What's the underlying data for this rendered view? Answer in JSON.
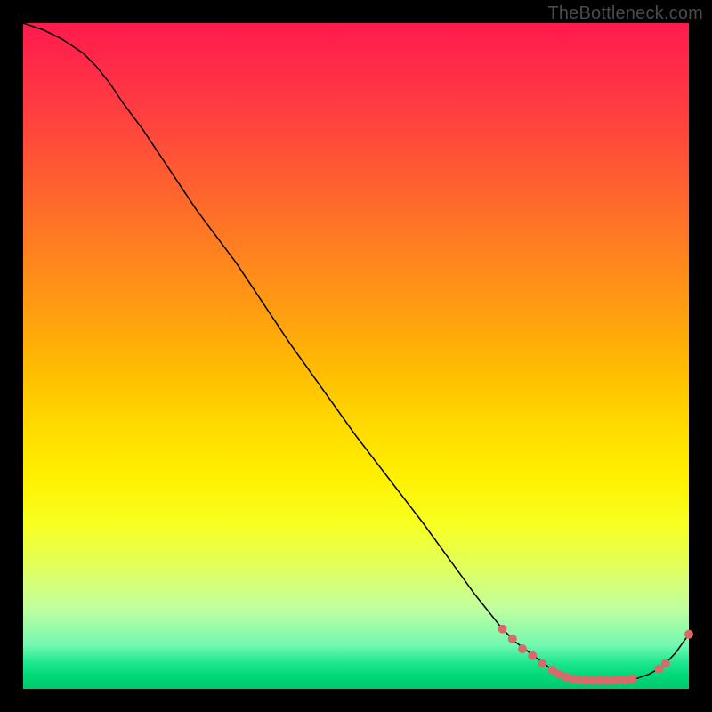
{
  "watermark_text": "TheBottleneck.com",
  "colors": {
    "black": "#000000",
    "dot": "#d86a6a",
    "gradient_top": "#ff1a4d",
    "gradient_bottom": "#00c86c"
  },
  "chart_data": {
    "type": "line",
    "title": "",
    "xlabel": "",
    "ylabel": "",
    "xlim": [
      0,
      100
    ],
    "ylim": [
      0,
      100
    ],
    "x": [
      0,
      3,
      6,
      9,
      11,
      13,
      15,
      18,
      22,
      26,
      32,
      40,
      50,
      60,
      68,
      72,
      74,
      76,
      78,
      79,
      80,
      81,
      82,
      83,
      84,
      85,
      86,
      88,
      90,
      92,
      94,
      96,
      98,
      100
    ],
    "y": [
      100,
      99,
      97.5,
      95.5,
      93.5,
      91,
      88,
      84,
      78,
      72,
      64,
      52,
      38,
      25,
      14,
      9,
      7,
      5.5,
      4,
      3.2,
      2.5,
      2,
      1.7,
      1.5,
      1.4,
      1.3,
      1.3,
      1.3,
      1.3,
      1.5,
      2.2,
      3.3,
      5.4,
      8.2
    ],
    "dot_points": [
      {
        "x": 72,
        "y": 9
      },
      {
        "x": 73.5,
        "y": 7.5
      },
      {
        "x": 75,
        "y": 6
      },
      {
        "x": 76.5,
        "y": 5
      },
      {
        "x": 78,
        "y": 3.8
      },
      {
        "x": 79.5,
        "y": 2.8
      },
      {
        "x": 80.5,
        "y": 2.2
      },
      {
        "x": 81.5,
        "y": 1.8
      },
      {
        "x": 82.5,
        "y": 1.5
      },
      {
        "x": 83.5,
        "y": 1.4
      },
      {
        "x": 84.5,
        "y": 1.3
      },
      {
        "x": 85.5,
        "y": 1.3
      },
      {
        "x": 86.5,
        "y": 1.3
      },
      {
        "x": 87.5,
        "y": 1.3
      },
      {
        "x": 88.5,
        "y": 1.3
      },
      {
        "x": 89.5,
        "y": 1.35
      },
      {
        "x": 90.5,
        "y": 1.35
      },
      {
        "x": 91.5,
        "y": 1.5
      },
      {
        "x": 95.5,
        "y": 3
      },
      {
        "x": 96.5,
        "y": 3.8
      },
      {
        "x": 100,
        "y": 8.2
      }
    ],
    "annotation_note": "tiny dotted text near trough, illegible at this resolution"
  }
}
